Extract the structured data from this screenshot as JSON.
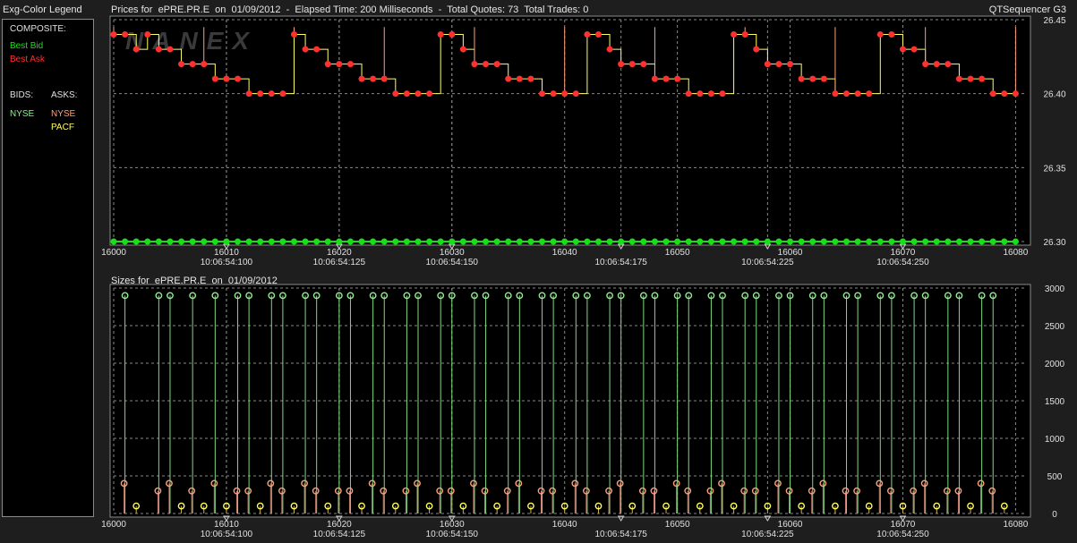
{
  "legend": {
    "title": "Exg-Color Legend",
    "composite_label": "COMPOSITE:",
    "best_bid": "Best Bid",
    "best_ask": "Best Ask",
    "bids_label": "BIDS:",
    "asks_label": "ASKS:",
    "bid_exchanges": [
      "NYSE"
    ],
    "ask_exchanges": [
      "NYSE",
      "PACF"
    ]
  },
  "prices_header": "Prices for  ePRE.PR.E  on  01/09/2012  -  Elapsed Time: 200 Milliseconds  -  Total Quotes: 73  Total Trades: 0",
  "app_name": "QTSequencer G3",
  "sizes_header": "Sizes for  ePRE.PR.E  on  01/09/2012",
  "colors": {
    "best_bid": "#18e018",
    "best_ask": "#ff3030",
    "nyse_bid": "#90ee90",
    "nyse_ask": "#ffa07a",
    "pacf_ask": "#ffff66",
    "axis_text": "#e0e0e0",
    "grid": "#888888"
  },
  "x_axis": {
    "seq_ticks": [
      "16000",
      "16010",
      "16020",
      "16030",
      "16040",
      "16050",
      "16060",
      "16070",
      "16080"
    ],
    "time_labels": [
      "10:06:54:100",
      "10:06:54:125",
      "10:06:54:150",
      "10:06:54:175",
      "10:06:54:225",
      "10:06:54:250"
    ]
  },
  "chart_data": [
    {
      "type": "line",
      "name": "prices",
      "xlim": [
        16000,
        16081
      ],
      "ylim": [
        26.3,
        26.45
      ],
      "y_ticks": [
        "26.45",
        "26.40",
        "26.35",
        "26.30"
      ],
      "series": [
        {
          "name": "Best Ask",
          "x": [
            16000,
            16001,
            16002,
            16003,
            16004,
            16005,
            16006,
            16007,
            16008,
            16009,
            16010,
            16011,
            16012,
            16013,
            16014,
            16015,
            16016,
            16017,
            16018,
            16019,
            16020,
            16021,
            16022,
            16023,
            16024,
            16025,
            16026,
            16027,
            16028,
            16029,
            16030,
            16031,
            16032,
            16033,
            16034,
            16035,
            16036,
            16037,
            16038,
            16039,
            16040,
            16041,
            16042,
            16043,
            16044,
            16045,
            16046,
            16047,
            16048,
            16049,
            16050,
            16051,
            16052,
            16053,
            16054,
            16055,
            16056,
            16057,
            16058,
            16059,
            16060,
            16061,
            16062,
            16063,
            16064,
            16065,
            16066,
            16067,
            16068,
            16069,
            16070,
            16071,
            16072,
            16073,
            16074,
            16075,
            16076,
            16077,
            16078,
            16079,
            16080
          ],
          "values": [
            26.44,
            26.44,
            26.43,
            26.44,
            26.43,
            26.43,
            26.42,
            26.42,
            26.42,
            26.41,
            26.41,
            26.41,
            26.4,
            26.4,
            26.4,
            26.4,
            26.44,
            26.43,
            26.43,
            26.42,
            26.42,
            26.42,
            26.41,
            26.41,
            26.41,
            26.4,
            26.4,
            26.4,
            26.4,
            26.44,
            26.44,
            26.43,
            26.42,
            26.42,
            26.42,
            26.41,
            26.41,
            26.41,
            26.4,
            26.4,
            26.4,
            26.4,
            26.44,
            26.44,
            26.43,
            26.42,
            26.42,
            26.42,
            26.41,
            26.41,
            26.41,
            26.4,
            26.4,
            26.4,
            26.4,
            26.44,
            26.44,
            26.43,
            26.42,
            26.42,
            26.42,
            26.41,
            26.41,
            26.41,
            26.4,
            26.4,
            26.4,
            26.4,
            26.44,
            26.44,
            26.43,
            26.43,
            26.42,
            26.42,
            26.42,
            26.41,
            26.41,
            26.41,
            26.4,
            26.4,
            26.4
          ]
        },
        {
          "name": "Best Bid",
          "x": [
            16000,
            16001,
            16002,
            16003,
            16004,
            16005,
            16006,
            16007,
            16008,
            16009,
            16010,
            16011,
            16012,
            16013,
            16014,
            16015,
            16016,
            16017,
            16018,
            16019,
            16020,
            16021,
            16022,
            16023,
            16024,
            16025,
            16026,
            16027,
            16028,
            16029,
            16030,
            16031,
            16032,
            16033,
            16034,
            16035,
            16036,
            16037,
            16038,
            16039,
            16040,
            16041,
            16042,
            16043,
            16044,
            16045,
            16046,
            16047,
            16048,
            16049,
            16050,
            16051,
            16052,
            16053,
            16054,
            16055,
            16056,
            16057,
            16058,
            16059,
            16060,
            16061,
            16062,
            16063,
            16064,
            16065,
            16066,
            16067,
            16068,
            16069,
            16070,
            16071,
            16072,
            16073,
            16074,
            16075,
            16076,
            16077,
            16078,
            16079,
            16080
          ],
          "values": [
            26.3,
            26.3,
            26.3,
            26.3,
            26.3,
            26.3,
            26.3,
            26.3,
            26.3,
            26.3,
            26.3,
            26.3,
            26.3,
            26.3,
            26.3,
            26.3,
            26.3,
            26.3,
            26.3,
            26.3,
            26.3,
            26.3,
            26.3,
            26.3,
            26.3,
            26.3,
            26.3,
            26.3,
            26.3,
            26.3,
            26.3,
            26.3,
            26.3,
            26.3,
            26.3,
            26.3,
            26.3,
            26.3,
            26.3,
            26.3,
            26.3,
            26.3,
            26.3,
            26.3,
            26.3,
            26.3,
            26.3,
            26.3,
            26.3,
            26.3,
            26.3,
            26.3,
            26.3,
            26.3,
            26.3,
            26.3,
            26.3,
            26.3,
            26.3,
            26.3,
            26.3,
            26.3,
            26.3,
            26.3,
            26.3,
            26.3,
            26.3,
            26.3,
            26.3,
            26.3,
            26.3,
            26.3,
            26.3,
            26.3,
            26.3,
            26.3,
            26.3,
            26.3,
            26.3,
            26.3,
            26.3
          ]
        }
      ]
    },
    {
      "type": "bar",
      "name": "sizes",
      "xlim": [
        16000,
        16081
      ],
      "ylim": [
        0,
        3000
      ],
      "y_ticks": [
        "3000",
        "2500",
        "2000",
        "1500",
        "1000",
        "500",
        "0"
      ],
      "series": [
        {
          "name": "NYSE Bid",
          "x": [
            16001,
            16004,
            16005,
            16007,
            16009,
            16011,
            16012,
            16014,
            16015,
            16017,
            16018,
            16020,
            16021,
            16023,
            16024,
            16026,
            16027,
            16029,
            16030,
            16032,
            16033,
            16035,
            16036,
            16038,
            16039,
            16041,
            16042,
            16044,
            16045,
            16047,
            16048,
            16050,
            16051,
            16053,
            16054,
            16056,
            16057,
            16059,
            16060,
            16062,
            16063,
            16065,
            16066,
            16068,
            16069,
            16071,
            16072,
            16074,
            16075,
            16077,
            16078
          ],
          "values": [
            2900,
            2900,
            2900,
            2900,
            2900,
            2900,
            2900,
            2900,
            2900,
            2900,
            2900,
            2900,
            2900,
            2900,
            2900,
            2900,
            2900,
            2900,
            2900,
            2900,
            2900,
            2900,
            2900,
            2900,
            2900,
            2900,
            2900,
            2900,
            2900,
            2900,
            2900,
            2900,
            2900,
            2900,
            2900,
            2900,
            2900,
            2900,
            2900,
            2900,
            2900,
            2900,
            2900,
            2900,
            2900,
            2900,
            2900,
            2900,
            2900,
            2900,
            2900
          ]
        },
        {
          "name": "NYSE Ask",
          "x": [
            16001,
            16004,
            16005,
            16007,
            16009,
            16011,
            16012,
            16014,
            16015,
            16017,
            16018,
            16020,
            16021,
            16023,
            16024,
            16026,
            16027,
            16029,
            16030,
            16032,
            16033,
            16035,
            16036,
            16038,
            16039,
            16041,
            16042,
            16044,
            16045,
            16047,
            16048,
            16050,
            16051,
            16053,
            16054,
            16056,
            16057,
            16059,
            16060,
            16062,
            16063,
            16065,
            16066,
            16068,
            16069,
            16071,
            16072,
            16074,
            16075,
            16077,
            16078
          ],
          "values": [
            400,
            300,
            400,
            300,
            400,
            300,
            300,
            400,
            300,
            400,
            300,
            300,
            300,
            400,
            300,
            300,
            400,
            300,
            300,
            400,
            300,
            300,
            400,
            300,
            300,
            400,
            300,
            300,
            400,
            300,
            300,
            400,
            300,
            300,
            400,
            300,
            300,
            400,
            300,
            300,
            400,
            300,
            300,
            400,
            300,
            300,
            400,
            300,
            300,
            400,
            300
          ]
        },
        {
          "name": "PACF Ask",
          "x": [
            16002,
            16006,
            16008,
            16010,
            16013,
            16016,
            16019,
            16022,
            16025,
            16028,
            16031,
            16034,
            16037,
            16040,
            16043,
            16046,
            16049,
            16052,
            16055,
            16058,
            16061,
            16064,
            16067,
            16070,
            16073,
            16076,
            16079
          ],
          "values": [
            100,
            100,
            100,
            100,
            100,
            100,
            100,
            100,
            100,
            100,
            100,
            100,
            100,
            100,
            100,
            100,
            100,
            100,
            100,
            100,
            100,
            100,
            100,
            100,
            100,
            100,
            100
          ]
        }
      ]
    }
  ]
}
